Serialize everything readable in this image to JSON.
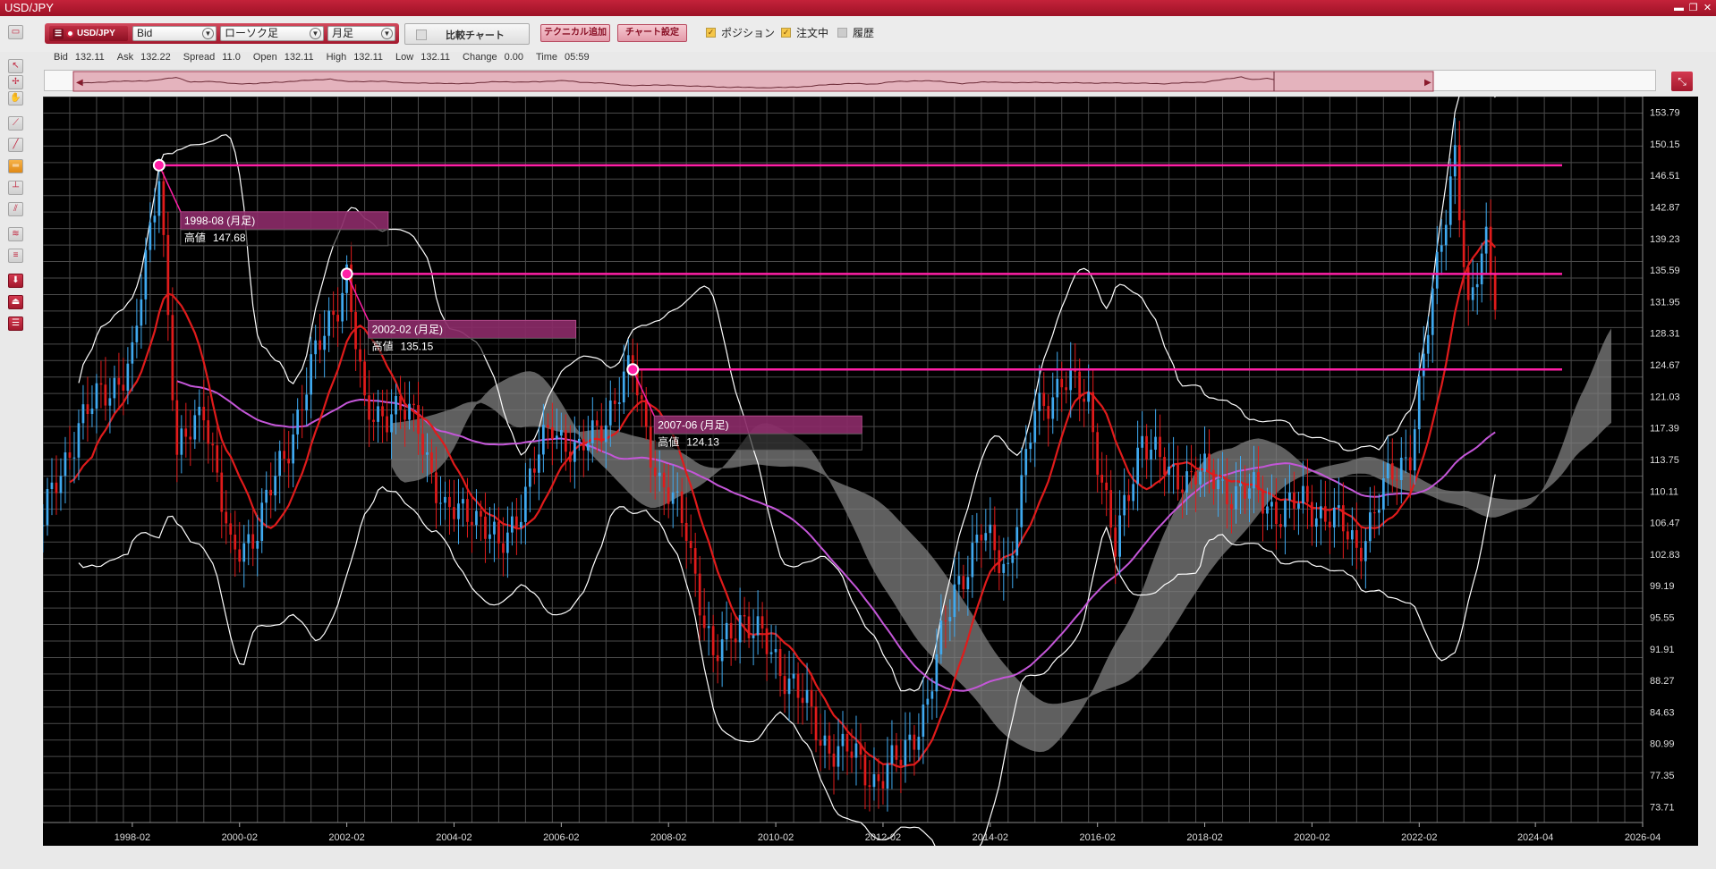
{
  "window": {
    "title": "USD/JPY"
  },
  "toolbar": {
    "symbol": "USD/JPY",
    "price_type": "Bid",
    "chart_type": "ローソク足",
    "period": "月足",
    "compare_label": "比較チャート",
    "add_technical_label": "テクニカル追加",
    "chart_settings_label": "チャート設定",
    "position_label": "ポジション",
    "orders_label": "注文中",
    "history_label": "履歴",
    "position_checked": true,
    "orders_checked": true,
    "history_checked": false
  },
  "quote": {
    "bid_label": "Bid",
    "bid": "132.11",
    "ask_label": "Ask",
    "ask": "132.22",
    "spread_label": "Spread",
    "spread": "11.0",
    "open_label": "Open",
    "open": "132.11",
    "high_label": "High",
    "high": "132.11",
    "low_label": "Low",
    "low": "132.11",
    "change_label": "Change",
    "change": "0.00",
    "time_label": "Time",
    "time": "05:59"
  },
  "left_tools": [
    "cursor-icon",
    "crosshair-cursor-icon",
    "hand-icon",
    "trendline-icon",
    "line-icon",
    "horizontal-line-icon",
    "vertical-line-icon",
    "channel-icon",
    "fibonacci-icon",
    "text-lines-icon",
    "download-icon",
    "alert-icon",
    "list-icon"
  ],
  "colors": {
    "accent": "#c8203a",
    "bull": "#3fa9ef",
    "bear": "#e01b1b",
    "ma_short": "#e01b1b",
    "ma_long": "#c456d8",
    "bands": "#ffffff",
    "annotation": "#ff1fa6",
    "cloud": "#7f7f7f"
  },
  "chart_data": {
    "type": "candlestick",
    "symbol": "USD/JPY",
    "timeframe": "月足",
    "x_range": [
      "1996-06",
      "2026-04"
    ],
    "y_range": [
      71.89,
      155.6
    ],
    "y_ticks": [
      "153.79",
      "150.15",
      "146.51",
      "142.87",
      "139.23",
      "135.59",
      "131.95",
      "128.31",
      "124.67",
      "121.03",
      "117.39",
      "113.75",
      "110.11",
      "106.47",
      "102.83",
      "99.19",
      "95.55",
      "91.91",
      "88.27",
      "84.63",
      "80.99",
      "77.35",
      "73.71"
    ],
    "x_ticks": [
      "1998-02",
      "2000-02",
      "2002-02",
      "2004-02",
      "2006-02",
      "2008-02",
      "2010-02",
      "2012-02",
      "2014-02",
      "2016-02",
      "2018-02",
      "2020-02",
      "2022-02",
      "2024-04",
      "2026-04"
    ],
    "price_path": [
      [
        "1996-06",
        106.5
      ],
      [
        "1997-02",
        118
      ],
      [
        "1997-08",
        121.5
      ],
      [
        "1998-02",
        125
      ],
      [
        "1998-08",
        147.68
      ],
      [
        "1998-12",
        113.5
      ],
      [
        "1999-06",
        120.5
      ],
      [
        "1999-12",
        102.5
      ],
      [
        "2000-06",
        106
      ],
      [
        "2000-12",
        114
      ],
      [
        "2001-06",
        124
      ],
      [
        "2002-02",
        135.15
      ],
      [
        "2002-06",
        119
      ],
      [
        "2002-12",
        119.5
      ],
      [
        "2003-06",
        118
      ],
      [
        "2003-12",
        107
      ],
      [
        "2004-06",
        108.5
      ],
      [
        "2004-12",
        103
      ],
      [
        "2005-06",
        110
      ],
      [
        "2005-12",
        118
      ],
      [
        "2006-06",
        114
      ],
      [
        "2006-12",
        119
      ],
      [
        "2007-06",
        124.13
      ],
      [
        "2007-12",
        111
      ],
      [
        "2008-06",
        106
      ],
      [
        "2008-12",
        90
      ],
      [
        "2009-06",
        96
      ],
      [
        "2009-12",
        92
      ],
      [
        "2010-06",
        88
      ],
      [
        "2010-12",
        81.5
      ],
      [
        "2011-06",
        80
      ],
      [
        "2011-12",
        77
      ],
      [
        "2012-06",
        79
      ],
      [
        "2012-12",
        86
      ],
      [
        "2013-06",
        99
      ],
      [
        "2013-12",
        105
      ],
      [
        "2014-06",
        101.5
      ],
      [
        "2014-12",
        119
      ],
      [
        "2015-06",
        123
      ],
      [
        "2015-12",
        120.5
      ],
      [
        "2016-06",
        103
      ],
      [
        "2016-12",
        117
      ],
      [
        "2017-06",
        111.5
      ],
      [
        "2017-12",
        112.5
      ],
      [
        "2018-06",
        110.5
      ],
      [
        "2018-12",
        110
      ],
      [
        "2019-06",
        108
      ],
      [
        "2019-12",
        108.5
      ],
      [
        "2020-06",
        107.5
      ],
      [
        "2020-12",
        103.5
      ],
      [
        "2021-06",
        110
      ],
      [
        "2021-12",
        115
      ],
      [
        "2022-06",
        135.5
      ],
      [
        "2022-10",
        150
      ],
      [
        "2023-01",
        130
      ],
      [
        "2023-05",
        139
      ],
      [
        "2023-07",
        133.5
      ]
    ],
    "annotations": [
      {
        "date": "1998-08 (月足)",
        "label": "高値",
        "value": "147.68",
        "price": 147.68,
        "month": "1998-08"
      },
      {
        "date": "2002-02 (月足)",
        "label": "高値",
        "value": "135.15",
        "price": 135.15,
        "month": "2002-02"
      },
      {
        "date": "2007-06 (月足)",
        "label": "高値",
        "value": "124.13",
        "price": 124.13,
        "month": "2007-06"
      }
    ],
    "horizontal_lines": [
      147.68,
      135.15,
      124.13
    ],
    "grid": true
  }
}
